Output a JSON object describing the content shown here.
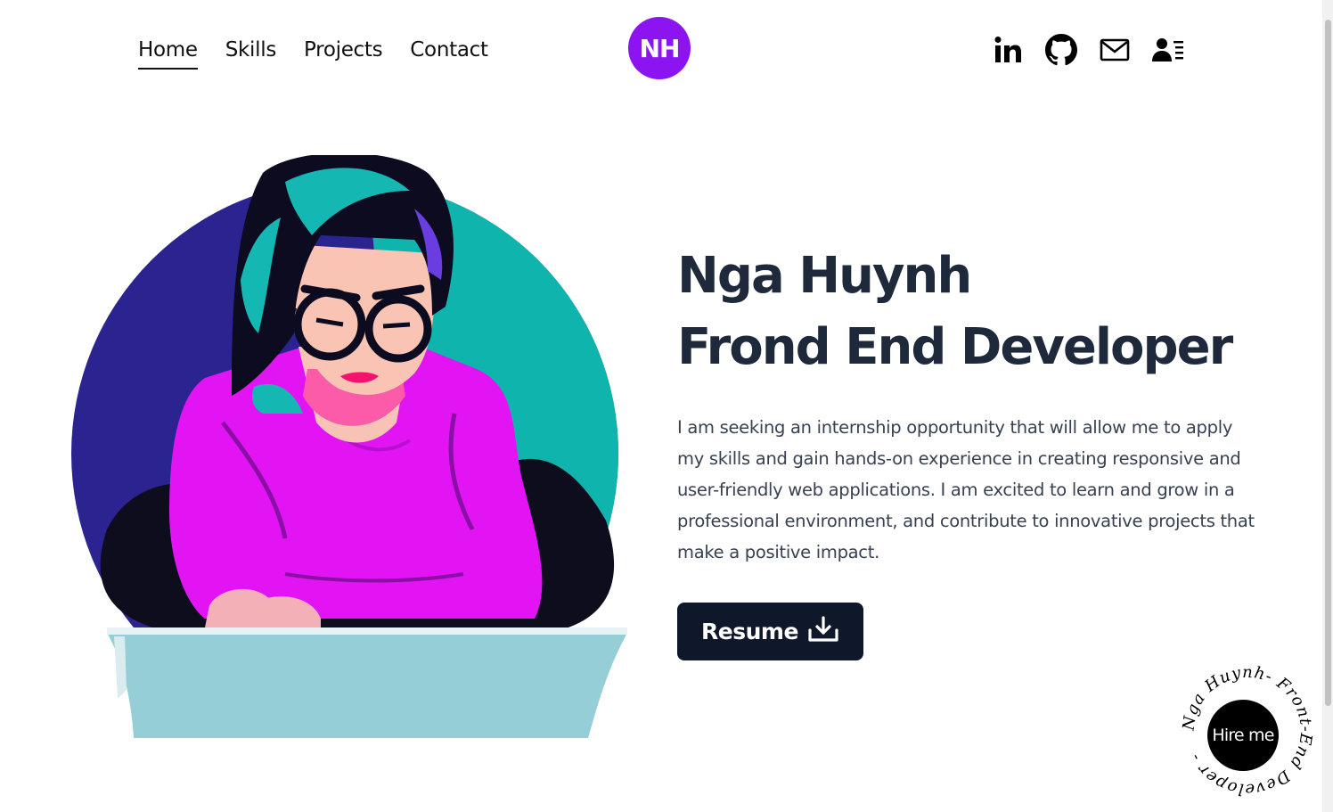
{
  "nav": {
    "items": [
      {
        "label": "Home",
        "active": true
      },
      {
        "label": "Skills",
        "active": false
      },
      {
        "label": "Projects",
        "active": false
      },
      {
        "label": "Contact",
        "active": false
      }
    ]
  },
  "logo": {
    "text": "NH",
    "color": "#8b14f0"
  },
  "socials": [
    {
      "icon": "linkedin-icon"
    },
    {
      "icon": "github-icon"
    },
    {
      "icon": "mail-icon"
    },
    {
      "icon": "profile-card-icon"
    }
  ],
  "hero": {
    "title_line1": "Nga Huynh",
    "title_line2": "Frond End Developer",
    "description": "I am seeking an internship opportunity that will allow me to apply my skills and gain hands-on experience in creating responsive and user-friendly web applications. I am excited to learn and grow in a professional environment, and contribute to innovative projects that make a positive impact.",
    "resume_label": "Resume"
  },
  "hire": {
    "button_label": "Hire me",
    "ring_text": "Nga Huynh- Front-End Developer - "
  },
  "colors": {
    "heading": "#1e293b",
    "button_bg": "#0f172a",
    "accent_purple": "#8b14f0"
  }
}
